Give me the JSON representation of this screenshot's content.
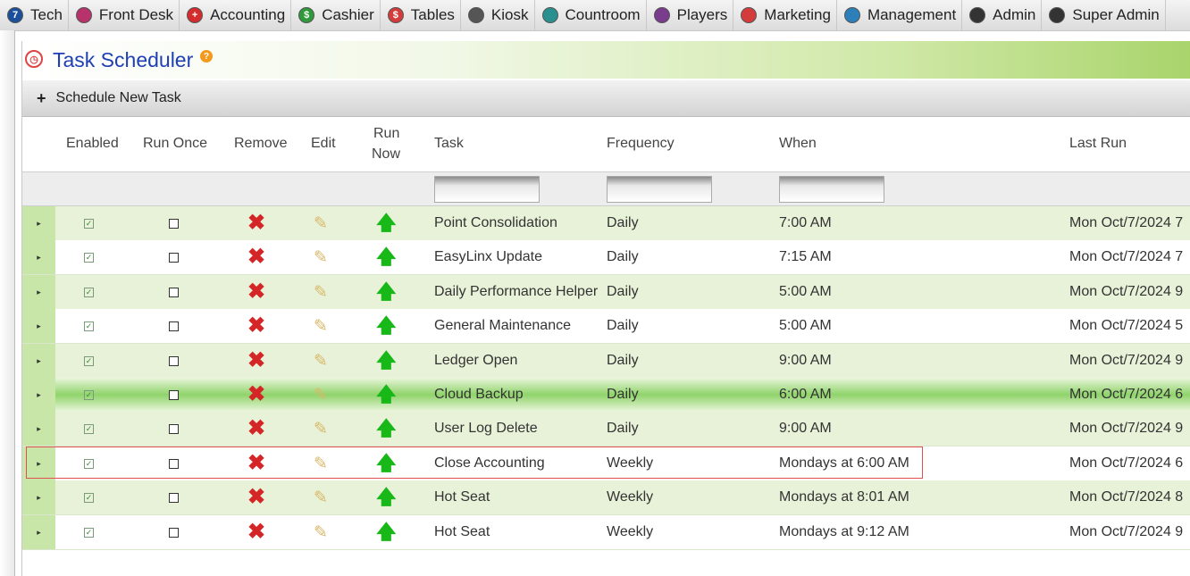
{
  "nav": [
    {
      "label": "Tech",
      "icon": "tech-icon",
      "glyph": "7",
      "color": "#1a4f9c"
    },
    {
      "label": "Front Desk",
      "icon": "front-desk-icon",
      "glyph": "",
      "color": "#b8326b"
    },
    {
      "label": "Accounting",
      "icon": "accounting-icon",
      "glyph": "+",
      "color": "#d42c2c"
    },
    {
      "label": "Cashier",
      "icon": "cashier-icon",
      "glyph": "$",
      "color": "#2e9a3a"
    },
    {
      "label": "Tables",
      "icon": "tables-icon",
      "glyph": "$",
      "color": "#d43c3c"
    },
    {
      "label": "Kiosk",
      "icon": "kiosk-icon",
      "glyph": "",
      "color": "#555555"
    },
    {
      "label": "Countroom",
      "icon": "countroom-icon",
      "glyph": "",
      "color": "#2a8f8f"
    },
    {
      "label": "Players",
      "icon": "players-icon",
      "glyph": "",
      "color": "#7a3c8c"
    },
    {
      "label": "Marketing",
      "icon": "marketing-icon",
      "glyph": "",
      "color": "#d43c3c"
    },
    {
      "label": "Management",
      "icon": "management-icon",
      "glyph": "",
      "color": "#2c7fb8"
    },
    {
      "label": "Admin",
      "icon": "admin-icon",
      "glyph": "",
      "color": "#333333"
    },
    {
      "label": "Super Admin",
      "icon": "super-admin-icon",
      "glyph": "",
      "color": "#333333"
    }
  ],
  "page": {
    "title": "Task Scheduler",
    "help": "?",
    "schedule_plus": "+",
    "schedule_label": "Schedule New Task"
  },
  "columns": {
    "enabled": "Enabled",
    "run_once": "Run Once",
    "remove": "Remove",
    "edit": "Edit",
    "run_now_1": "Run",
    "run_now_2": "Now",
    "task": "Task",
    "frequency": "Frequency",
    "when": "When",
    "last_run": "Last Run"
  },
  "filters": {
    "task": "",
    "frequency": "",
    "when": ""
  },
  "rows": [
    {
      "task": "Point Consolidation",
      "frequency": "Daily",
      "when": "7:00 AM",
      "last_run": "Mon Oct/7/2024 7",
      "enabled": true,
      "run_once": false
    },
    {
      "task": "EasyLinx Update",
      "frequency": "Daily",
      "when": "7:15 AM",
      "last_run": "Mon Oct/7/2024 7",
      "enabled": true,
      "run_once": false
    },
    {
      "task": "Daily Performance Helper",
      "frequency": "Daily",
      "when": "5:00 AM",
      "last_run": "Mon Oct/7/2024 9",
      "enabled": true,
      "run_once": false
    },
    {
      "task": "General Maintenance",
      "frequency": "Daily",
      "when": "5:00 AM",
      "last_run": "Mon Oct/7/2024 5",
      "enabled": true,
      "run_once": false
    },
    {
      "task": "Ledger Open",
      "frequency": "Daily",
      "when": "9:00 AM",
      "last_run": "Mon Oct/7/2024 9",
      "enabled": true,
      "run_once": false
    },
    {
      "task": "Cloud Backup",
      "frequency": "Daily",
      "when": "6:00 AM",
      "last_run": "Mon Oct/7/2024 6",
      "enabled": true,
      "run_once": false
    },
    {
      "task": "User Log Delete",
      "frequency": "Daily",
      "when": "9:00 AM",
      "last_run": "Mon Oct/7/2024 9",
      "enabled": true,
      "run_once": false
    },
    {
      "task": "Close Accounting",
      "frequency": "Weekly",
      "when": "Mondays at 6:00 AM",
      "last_run": "Mon Oct/7/2024 6",
      "enabled": true,
      "run_once": false
    },
    {
      "task": "Hot Seat",
      "frequency": "Weekly",
      "when": "Mondays at 8:01 AM",
      "last_run": "Mon Oct/7/2024 8",
      "enabled": true,
      "run_once": false
    },
    {
      "task": "Hot Seat",
      "frequency": "Weekly",
      "when": "Mondays at 9:12 AM",
      "last_run": "Mon Oct/7/2024 9",
      "enabled": true,
      "run_once": false
    }
  ],
  "glyphs": {
    "expander": "▸",
    "check": "✓",
    "remove": "✖",
    "edit": "✎",
    "run_now": "🡅"
  }
}
